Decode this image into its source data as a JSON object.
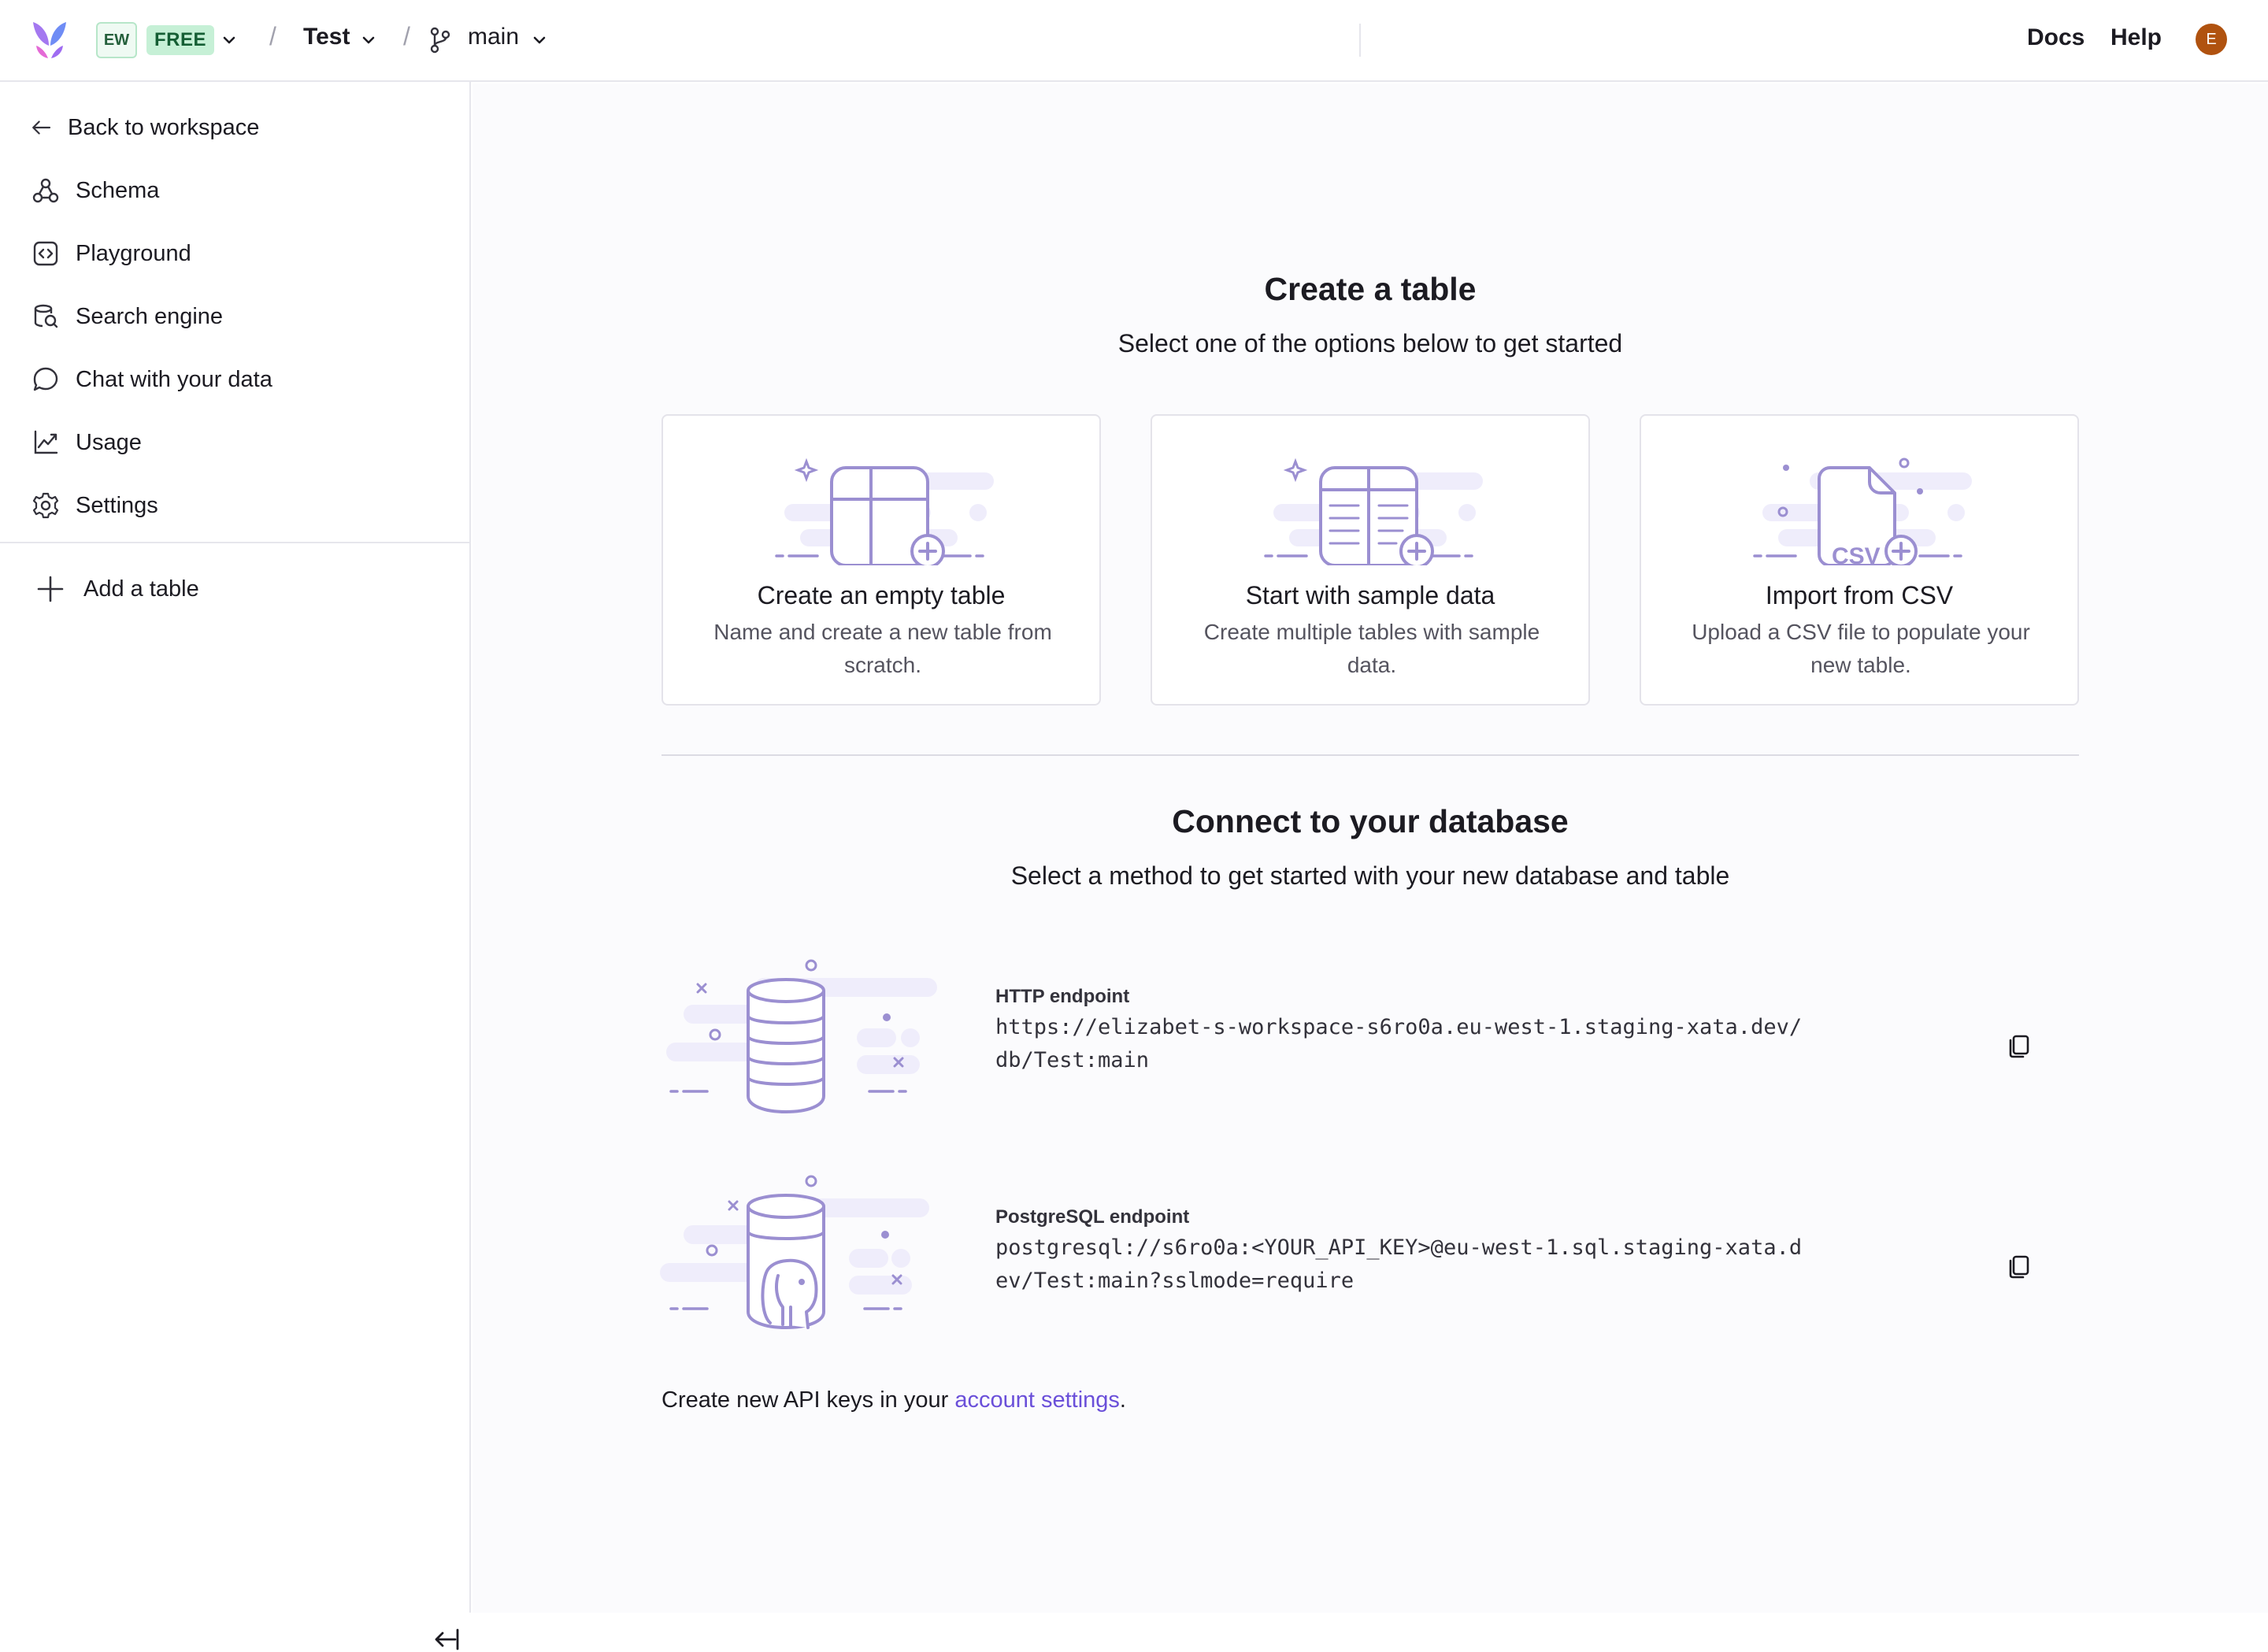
{
  "topbar": {
    "workspace_initials": "EW",
    "plan": "FREE",
    "database": "Test",
    "branch": "main",
    "docs_label": "Docs",
    "help_label": "Help",
    "avatar_initial": "E"
  },
  "sidebar": {
    "back_label": "Back to workspace",
    "items": [
      {
        "label": "Schema",
        "icon": "schema-icon"
      },
      {
        "label": "Playground",
        "icon": "code-icon"
      },
      {
        "label": "Search engine",
        "icon": "search-database-icon"
      },
      {
        "label": "Chat with your data",
        "icon": "chat-icon"
      },
      {
        "label": "Usage",
        "icon": "chart-icon"
      },
      {
        "label": "Settings",
        "icon": "gear-icon"
      }
    ],
    "add_table_label": "Add a table"
  },
  "create": {
    "title": "Create a table",
    "subtitle": "Select one of the options below to get started",
    "cards": [
      {
        "title": "Create an empty table",
        "description": "Name and create a new table from scratch."
      },
      {
        "title": "Start with sample data",
        "description": "Create multiple tables with sample data."
      },
      {
        "title": "Import from CSV",
        "description": "Upload a CSV file to populate your new table."
      }
    ],
    "csv_badge": "CSV"
  },
  "connect": {
    "title": "Connect to your database",
    "subtitle": "Select a method to get started with your new database and table",
    "http": {
      "label": "HTTP endpoint",
      "url": "https://elizabet-s-workspace-s6ro0a.eu-west-1.staging-xata.dev/db/Test:main"
    },
    "postgres": {
      "label": "PostgreSQL endpoint",
      "url": "postgresql://s6ro0a:<YOUR_API_KEY>@eu-west-1.sql.staging-xata.dev/Test:main?sslmode=require"
    },
    "footer_prefix": "Create new API keys in your ",
    "footer_link": "account settings",
    "footer_suffix": "."
  },
  "colors": {
    "accent": "#6a4fd9",
    "illustration": "#9b8fd1",
    "illustration_bg": "#efedfb",
    "plan_badge": "#c6f0d6",
    "avatar": "#b0520f"
  }
}
